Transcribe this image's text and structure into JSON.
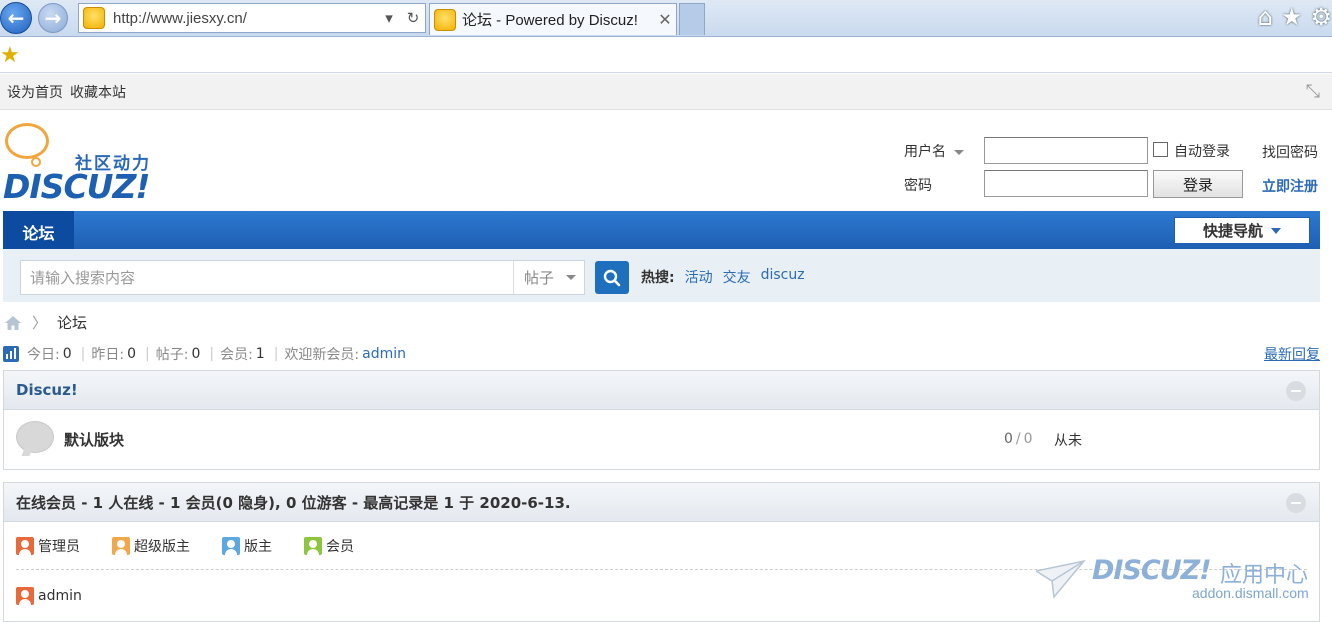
{
  "browser": {
    "url": "http://www.jiesxy.cn/",
    "tab_title": "论坛 - Powered by Discuz!",
    "tab_close": "✕"
  },
  "topbar": {
    "set_home": "设为首页",
    "bookmark": "收藏本站"
  },
  "logo": {
    "cn": "社区动力",
    "en": "DISCUZ!"
  },
  "login": {
    "username_label": "用户名",
    "password_label": "密码",
    "auto_login": "自动登录",
    "login_button": "登录",
    "forgot_password": "找回密码",
    "register": "立即注册"
  },
  "nav": {
    "forum": "论坛",
    "quick_nav": "快捷导航"
  },
  "search": {
    "placeholder": "请输入搜索内容",
    "type": "帖子",
    "hot_label": "热搜:",
    "hot_items": [
      "活动",
      "交友",
      "discuz"
    ]
  },
  "breadcrumb": {
    "current": "论坛"
  },
  "stats": {
    "today_label": "今日:",
    "today": "0",
    "yesterday_label": "昨日:",
    "yesterday": "0",
    "posts_label": "帖子:",
    "posts": "0",
    "members_label": "会员:",
    "members": "1",
    "welcome_label": "欢迎新会员:",
    "newest_member": "admin",
    "latest_reply": "最新回复"
  },
  "category": {
    "title": "Discuz!",
    "forums": [
      {
        "name": "默认版块",
        "threads": "0",
        "posts": "0",
        "last_post": "从未"
      }
    ]
  },
  "online": {
    "title": "在线会员 - 1 人在线 - 1 会员(0 隐身), 0 位游客 - 最高记录是 1 于 2020-6-13.",
    "legend": [
      {
        "label": "管理员",
        "color": "#e8693a"
      },
      {
        "label": "超级版主",
        "color": "#f0a84a"
      },
      {
        "label": "版主",
        "color": "#5aa9e0"
      },
      {
        "label": "会员",
        "color": "#8cc63e"
      }
    ],
    "users": [
      {
        "name": "admin",
        "color": "#e8693a"
      }
    ]
  },
  "watermark": {
    "brand": "DISCUZ!",
    "cn": "应用中心",
    "url": "addon.dismall.com"
  },
  "colors": {
    "nav_blue": "#1e5fb3",
    "link_blue": "#2b6bb5",
    "search_bg": "#e8eff5"
  }
}
